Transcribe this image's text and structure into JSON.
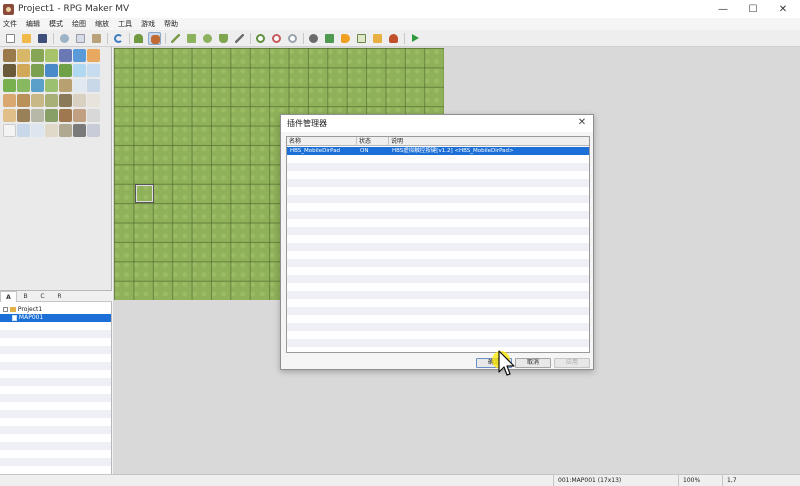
{
  "window": {
    "title": "Project1 - RPG Maker MV",
    "minimize": "—",
    "maximize": "☐",
    "close": "✕"
  },
  "menu": [
    "文件",
    "编辑",
    "模式",
    "绘图",
    "缩放",
    "工具",
    "游戏",
    "帮助"
  ],
  "toolbar_icons": [
    "new-project-icon",
    "open-project-icon",
    "save-project-icon",
    "cut-icon",
    "copy-icon",
    "paste-icon",
    "undo-icon",
    "map-mode-icon",
    "event-mode-icon",
    "pencil-icon",
    "rectangle-icon",
    "ellipse-icon",
    "fill-icon",
    "shadow-pen-icon",
    "zoom-in-icon",
    "zoom-out-icon",
    "zoom-actual-icon",
    "database-icon",
    "plugin-manager-icon",
    "sound-test-icon",
    "event-searcher-icon",
    "resource-manager-icon",
    "character-generator-icon",
    "playtest-icon"
  ],
  "tileset_tabs": [
    "A",
    "B",
    "C",
    "R"
  ],
  "map_tree": {
    "root": "Project1",
    "maps": [
      "MAP001"
    ]
  },
  "status": {
    "map": "001:MAP001 (17x13)",
    "zoom": "100%",
    "coords": "1,7"
  },
  "plugin_dialog": {
    "title": "插件管理器",
    "columns": [
      "名称",
      "状态",
      "说明"
    ],
    "plugins": [
      {
        "name": "HBS_MobileDirPad",
        "status": "ON",
        "description": "HBS虚拟触控按键[v1.2] <HBS_MobileDirPad>"
      }
    ],
    "buttons": {
      "ok": "确定",
      "cancel": "取消",
      "apply": "应用"
    }
  },
  "colors": {
    "selection": "#1c6fd6",
    "grass": "#8fb15a",
    "panel": "#d9d9d9"
  }
}
